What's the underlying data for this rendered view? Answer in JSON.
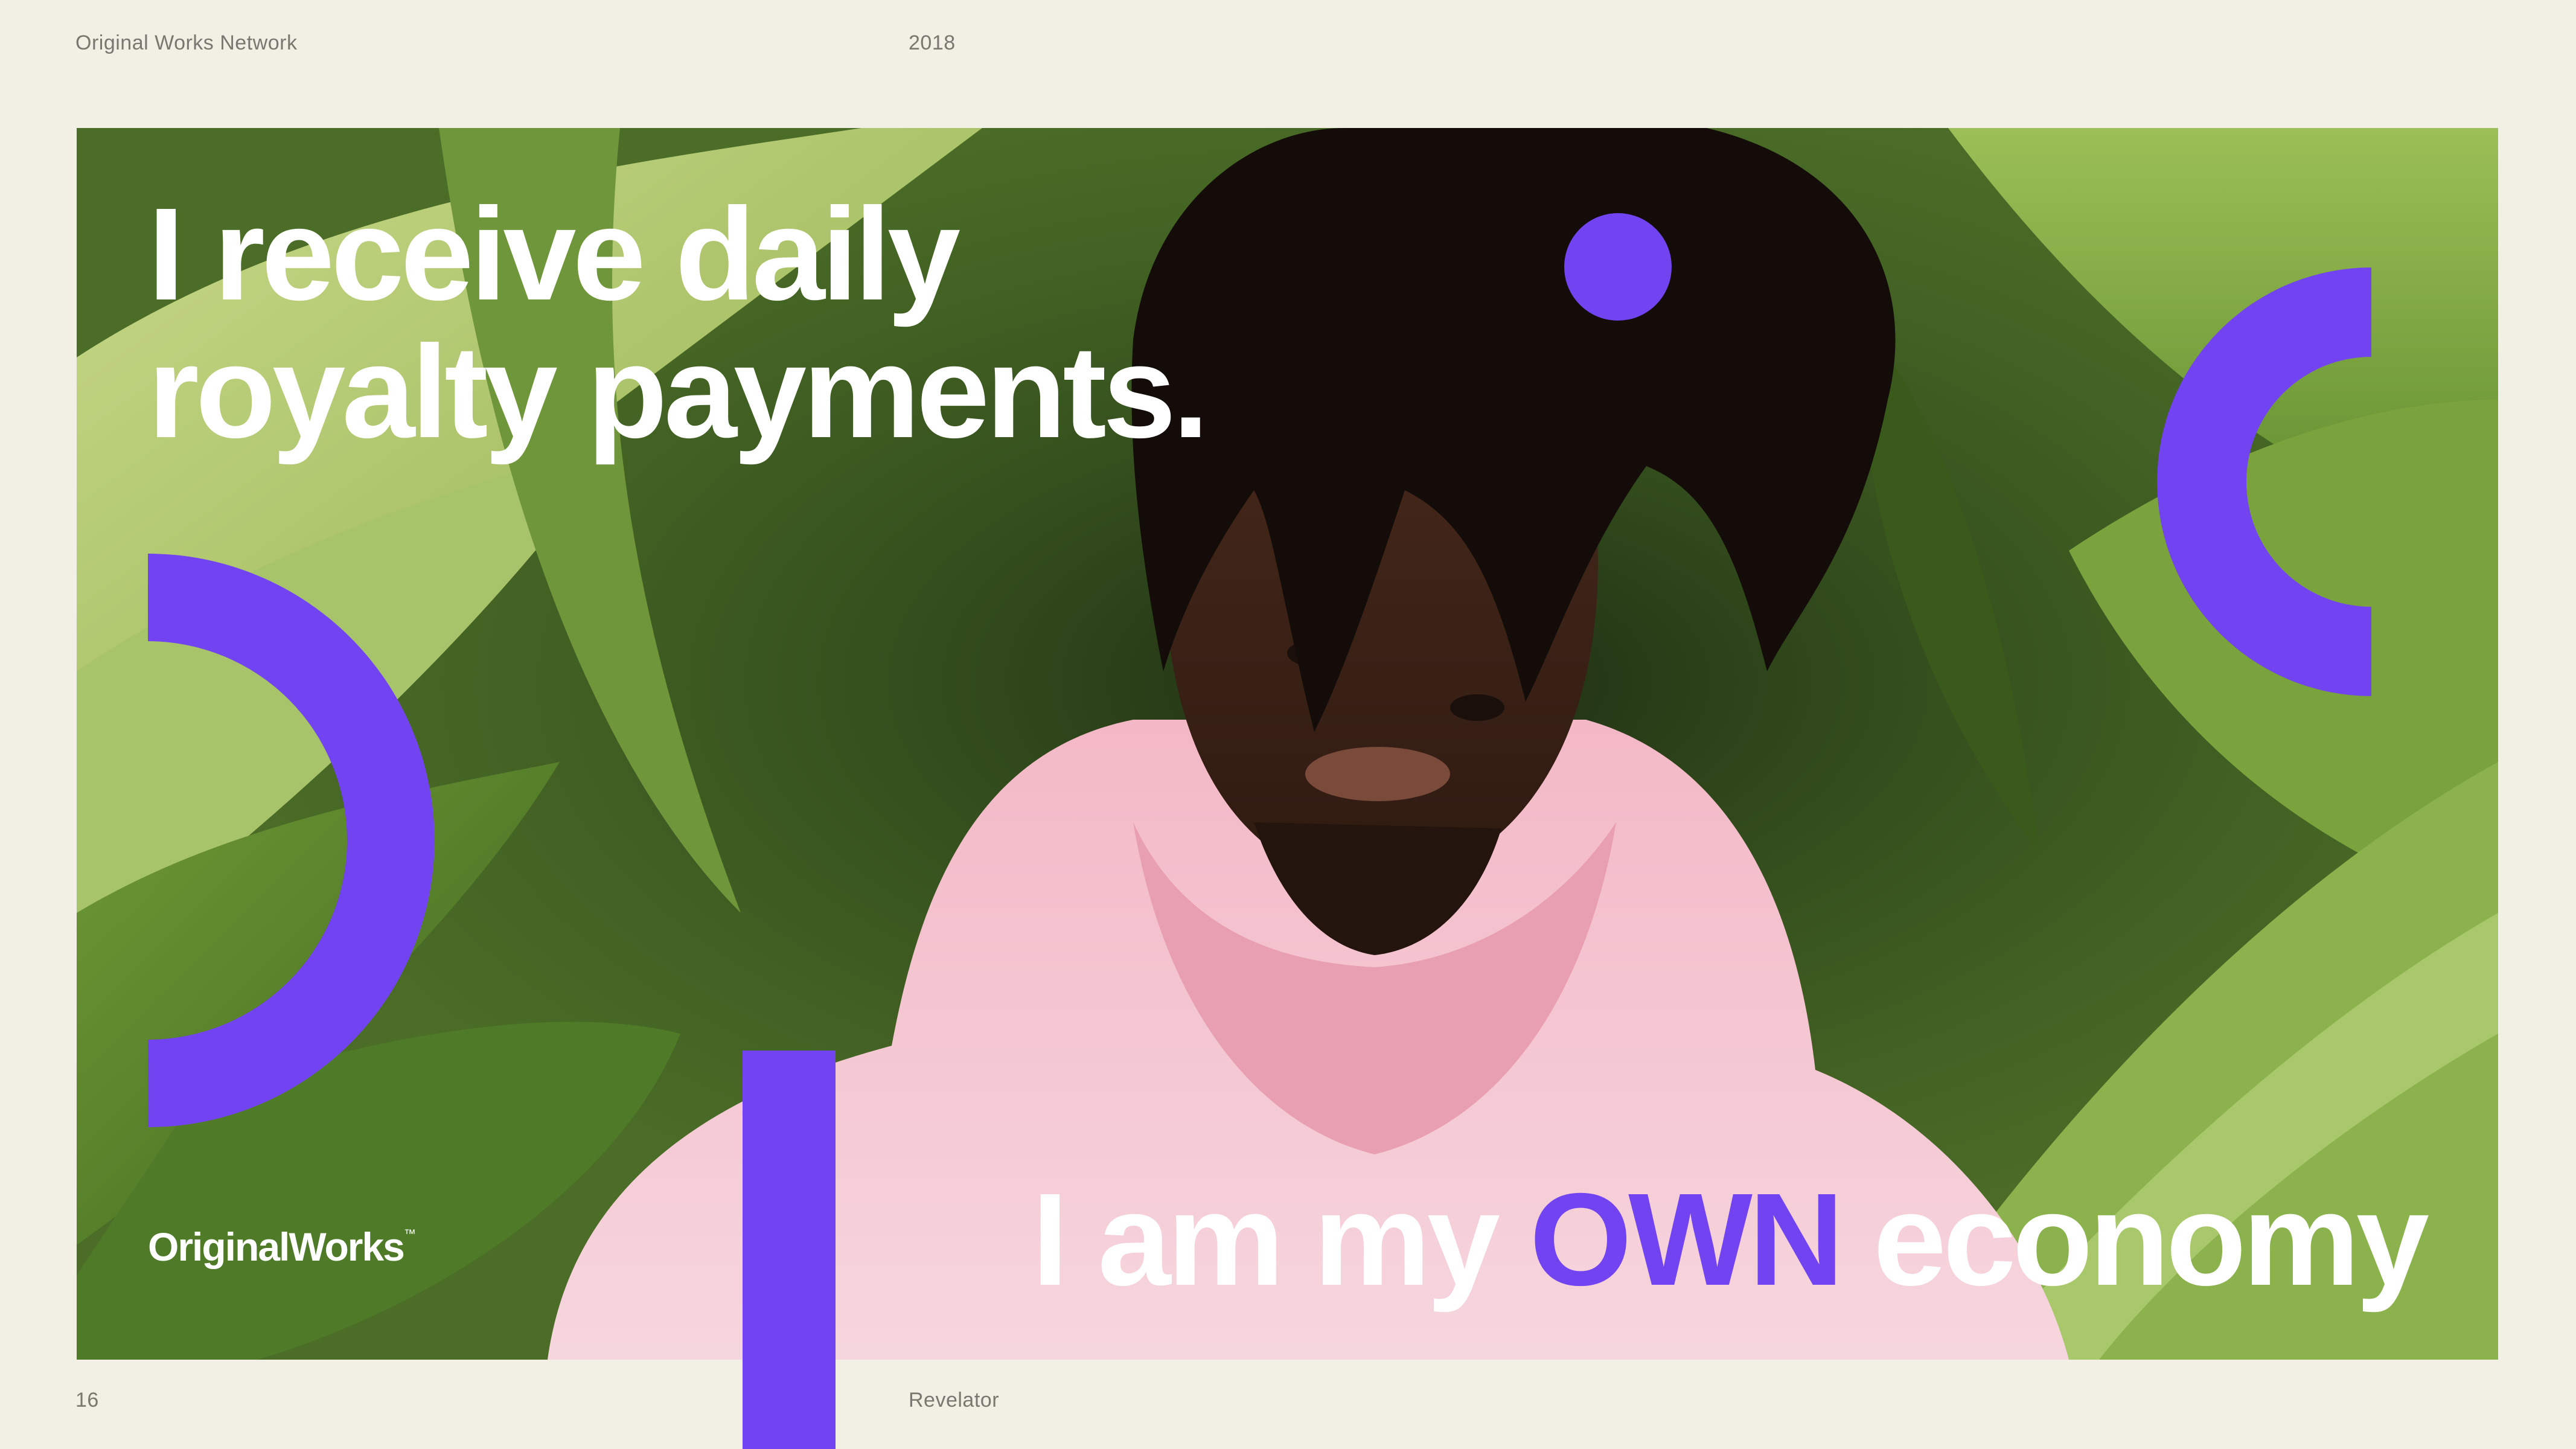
{
  "header": {
    "left_label": "Original Works Network",
    "year": "2018"
  },
  "footer": {
    "page_number": "16",
    "center_label": "Revelator"
  },
  "hero": {
    "headline_line1": "I receive daily",
    "headline_line2": "royalty payments.",
    "tagline_before": "I am my",
    "tagline_accent": "OWN",
    "tagline_after": "economy"
  },
  "logo": {
    "text": "OriginalWorks",
    "trademark": "™"
  },
  "colors": {
    "accent": "#7243f0",
    "background": "#f2efe4",
    "text_on_photo": "#ffffff",
    "meta_text": "#7a7770"
  },
  "photo": {
    "subject": "portrait-photo"
  }
}
